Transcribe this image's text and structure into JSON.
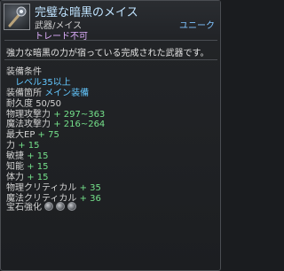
{
  "item": {
    "name": "完璧な暗黒のメイス",
    "type": "武器/メイス",
    "rarity": "ユニーク",
    "trade": "トレード不可",
    "description": "強力な暗黒の力が宿っている完成された武器です。",
    "icon": "mace-icon"
  },
  "requirements": {
    "label": "装備条件",
    "level": "レベル35以上"
  },
  "equip_slot": {
    "label": "装備箇所",
    "value": "メイン装備"
  },
  "durability": {
    "label": "耐久度",
    "value": "50/50"
  },
  "stats": [
    {
      "label": "物理攻撃力",
      "value": "+ 297~363"
    },
    {
      "label": "魔法攻撃力",
      "value": "+ 216~264"
    },
    {
      "label": "最大EP",
      "value": "+ 75"
    },
    {
      "label": "力",
      "value": "+ 15"
    },
    {
      "label": "敏捷",
      "value": "+ 15"
    },
    {
      "label": "知能",
      "value": "+ 15"
    },
    {
      "label": "体力",
      "value": "+ 15"
    },
    {
      "label": "物理クリティカル",
      "value": "+ 35"
    },
    {
      "label": "魔法クリティカル",
      "value": "+ 36"
    }
  ],
  "gem_enhance": {
    "label": "宝石強化",
    "slots": [
      "gem-slot-icon",
      "gem-slot-icon",
      "gem-slot-icon"
    ]
  },
  "colors": {
    "name": "#bfe3ff",
    "rarity": "#7fc3ff",
    "trade": "#e0b0ff",
    "stat_value": "#74e08a",
    "requirement": "#63c7ff"
  }
}
